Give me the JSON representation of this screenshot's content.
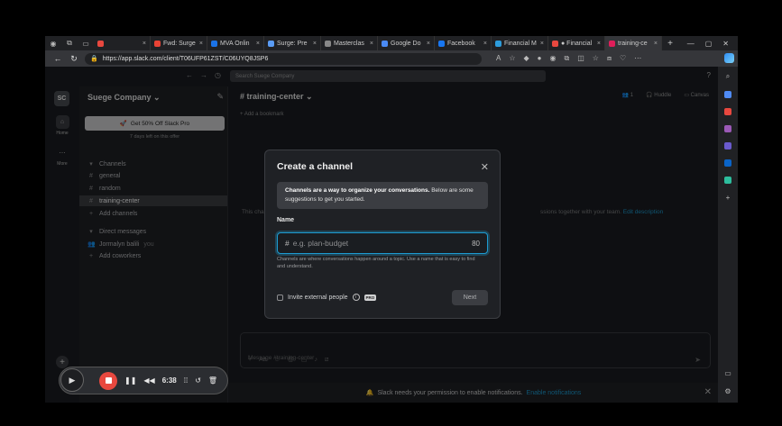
{
  "browser": {
    "tabs": [
      {
        "label": "",
        "color": "#e8483f",
        "active": false
      },
      {
        "label": "Fwd: Surge",
        "color": "#ea4335",
        "active": false
      },
      {
        "label": "MVA Onlin",
        "color": "#1a73e8",
        "active": false
      },
      {
        "label": "Surge: Pre",
        "color": "#5a9cf5",
        "active": false
      },
      {
        "label": "Masterclas",
        "color": "#888888",
        "active": false
      },
      {
        "label": "Google Do",
        "color": "#4a8af4",
        "active": false
      },
      {
        "label": "Facebook",
        "color": "#1877f2",
        "active": false
      },
      {
        "label": "Financial M",
        "color": "#2d9cdb",
        "active": false
      },
      {
        "label": "● Financial",
        "color": "#e8483f",
        "active": false
      },
      {
        "label": "training-ce",
        "color": "#e01e5a",
        "active": true
      }
    ],
    "url": "https://app.slack.com/client/T06UFP61ZST/C06UYQ8JSP6"
  },
  "slack": {
    "search_placeholder": "Search Suege Company",
    "workspace_initials": "SC",
    "workspace_name": "Suege Company ⌄",
    "rail": {
      "home": "Home",
      "more": "More"
    },
    "promo": {
      "label": "Get 50% Off Slack Pro",
      "sub": "7 days left on this offer"
    },
    "sidebar": {
      "channels_header": "Channels",
      "channels": [
        "general",
        "random",
        "training-center"
      ],
      "add_channels": "Add channels",
      "dm_header": "Direct messages",
      "dm_user": "Jormalyn balili",
      "dm_you": "you",
      "add_coworkers": "Add coworkers"
    },
    "channel": {
      "title": "# training-center ⌄",
      "members": "1",
      "huddle": "Huddle",
      "canvas": "Canvas",
      "bookmark": "+ Add a bookmark",
      "bg_text_left": "This cha",
      "bg_text_right": "ssions together with your team.",
      "bg_link": "Edit description",
      "composer_placeholder": "Message #training-center"
    },
    "notification": {
      "text": "Slack needs your permission to enable notifications.",
      "link": "Enable notifications"
    }
  },
  "modal": {
    "title": "Create a channel",
    "info_bold": "Channels are a way to organize your conversations.",
    "info_rest": " Below are some suggestions to get you started.",
    "name_label": "Name",
    "input_placeholder": "e.g. plan-budget",
    "char_count": "80",
    "helper": "Channels are where conversations happen around a topic. Use a name that is easy to find and understand.",
    "invite_label": "Invite external people",
    "pro_badge": "PRO",
    "next_label": "Next"
  },
  "recorder": {
    "time": "6:38"
  }
}
